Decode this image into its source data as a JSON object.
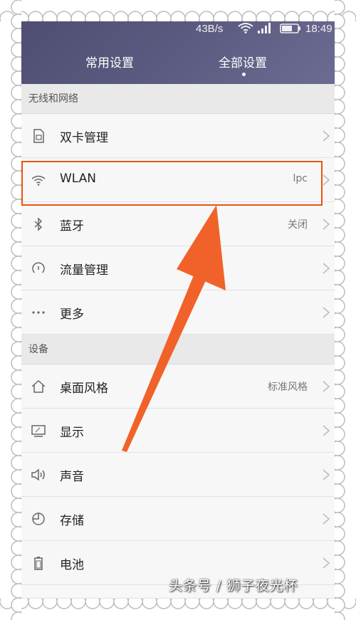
{
  "status_bar": {
    "speed": "43B/s",
    "time": "18:49"
  },
  "tabs": [
    {
      "label": "常用设置",
      "active": false
    },
    {
      "label": "全部设置",
      "active": true
    }
  ],
  "sections": [
    {
      "title": "无线和网络",
      "items": [
        {
          "label": "双卡管理",
          "value": "",
          "icon": "sim-card-icon"
        },
        {
          "label": "WLAN",
          "value": "lpc",
          "icon": "wifi-icon",
          "highlighted": true
        },
        {
          "label": "蓝牙",
          "value": "关闭",
          "icon": "bluetooth-icon"
        },
        {
          "label": "流量管理",
          "value": "",
          "icon": "data-usage-icon"
        },
        {
          "label": "更多",
          "value": "",
          "icon": "more-icon"
        }
      ]
    },
    {
      "title": "设备",
      "items": [
        {
          "label": "桌面风格",
          "value": "标准风格",
          "icon": "home-icon"
        },
        {
          "label": "显示",
          "value": "",
          "icon": "display-icon"
        },
        {
          "label": "声音",
          "value": "",
          "icon": "sound-icon"
        },
        {
          "label": "存储",
          "value": "",
          "icon": "storage-icon"
        },
        {
          "label": "电池",
          "value": "",
          "icon": "battery-icon"
        }
      ]
    }
  ],
  "watermark": "头条号 / 狮子夜光杯",
  "colors": {
    "header": "#5b5a80",
    "highlight": "#e8540f",
    "arrow": "#f0622a"
  }
}
